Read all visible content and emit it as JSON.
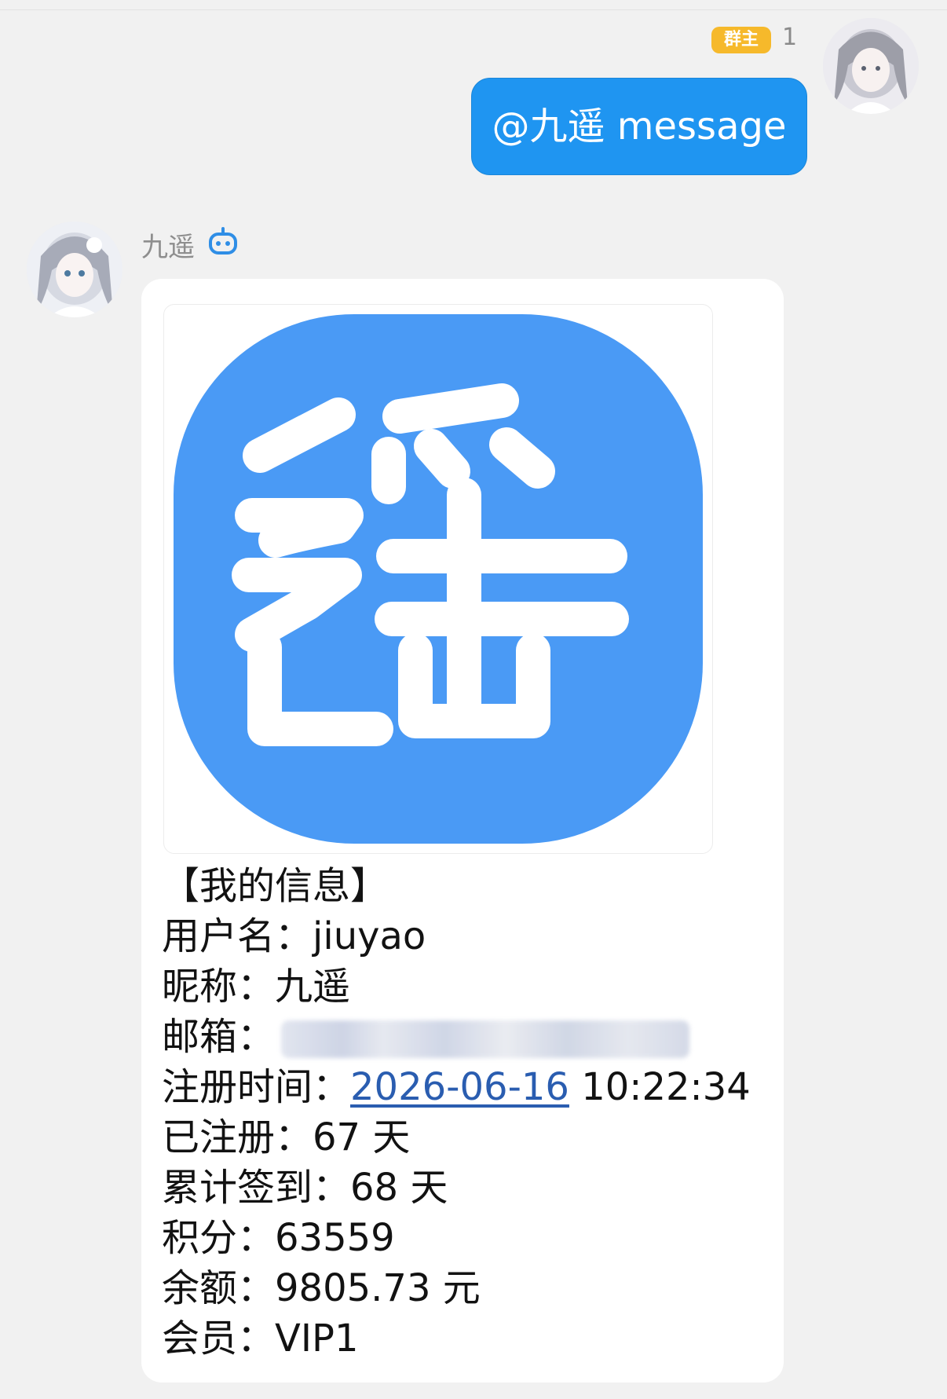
{
  "own_message": {
    "role_badge": "群主",
    "count": "1",
    "text": "@九遥 message"
  },
  "bot_message": {
    "sender_name": "九遥",
    "info": {
      "heading": "【我的信息】",
      "rows": [
        {
          "label": "用户名：",
          "value": "jiuyao"
        },
        {
          "label": "昵称：",
          "value": "九遥"
        },
        {
          "label": "邮箱：",
          "value": ""
        },
        {
          "label": "注册时间：",
          "date": "2026-06-16",
          "time": " 10:22:34"
        },
        {
          "label": "已注册：",
          "value": "67 天"
        },
        {
          "label": "累计签到：",
          "value": "68 天"
        },
        {
          "label": "积分：",
          "value": "63559"
        },
        {
          "label": "余额：",
          "value": "9805.73 元"
        },
        {
          "label": "会员：",
          "value": "VIP1"
        }
      ]
    }
  },
  "colors": {
    "bubble_blue": "#1f95f1",
    "logo_blue": "#4a9af5",
    "badge_yellow": "#f6b92b",
    "link_blue": "#2a5db0"
  },
  "icons": {
    "bot_badge": "robot-icon",
    "avatar": "anime-avatar"
  }
}
